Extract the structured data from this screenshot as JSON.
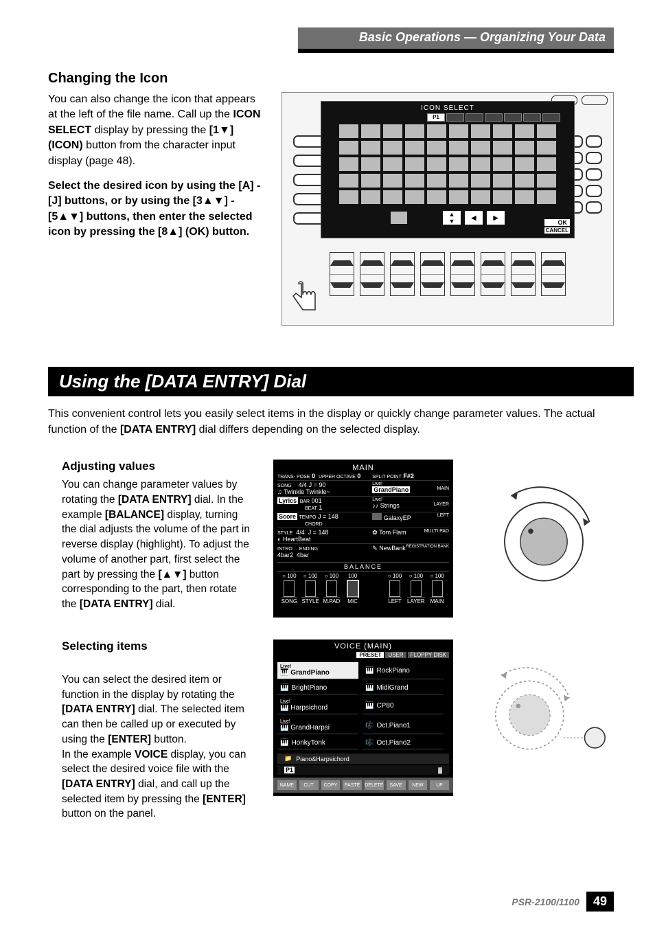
{
  "header": {
    "breadcrumb": "Basic Operations — Organizing Your Data"
  },
  "section_icon": {
    "heading": "Changing the Icon",
    "para1_a": "You can also change the icon that appears at the left of the file name. Call up the ",
    "para1_b": "ICON SELECT",
    "para1_c": " display by pressing the ",
    "para1_d": "[1▼] (ICON)",
    "para1_e": " button from the character input display (page 48).",
    "para2_a": "Select the desired icon by using the [A] - [J] buttons, or by using the [3",
    "para2_b": "] - [5",
    "para2_c": "] buttons, then enter the selected icon by pressing the [8",
    "para2_d": "] (OK) button."
  },
  "lcd_icon": {
    "title": "ICON SELECT",
    "page": "P1",
    "ok": "OK",
    "cancel": "CANCEL"
  },
  "banner": "Using the [DATA ENTRY] Dial",
  "intro_a": "This convenient control lets you easily select items in the display or quickly change parameter values. The actual function of the ",
  "intro_b": "[DATA ENTRY]",
  "intro_c": " dial differs depending on the selected display.",
  "adjust": {
    "heading": "Adjusting values",
    "body_a": "You can change parameter values by rotating the ",
    "body_b": "[DATA ENTRY]",
    "body_c": " dial. In the example ",
    "body_d": "[BALANCE]",
    "body_e": " display, turning the dial adjusts the volume of the part in reverse display (highlight). To adjust the volume of another part, first select the part by pressing the ",
    "body_f": "[",
    "body_g": "]",
    "body_h": " button corresponding to the part, then rotate the ",
    "body_i": "[DATA ENTRY]",
    "body_j": " dial."
  },
  "lcd_main": {
    "title": "MAIN",
    "trans": "TRANS-\nPOSE",
    "trans_v": "0",
    "octave": "UPPER\nOCTAVE",
    "octave_v": "0",
    "split": "SPLIT\nPOINT",
    "split_v": "F#2",
    "song": "SONG",
    "song_name": "Twinkle Twinkle~",
    "time": "4/4",
    "tempo": "J = 90",
    "lyrics": "Lyrics",
    "bar": "BAR",
    "bar_v": "001",
    "beat": "BEAT",
    "beat_v": "1",
    "score": "Score",
    "tempo_l": "TEMPO",
    "tempo_v": "J = 148",
    "chord": "CHORD",
    "style": "STYLE",
    "style_name": "HeartBeat",
    "intro": "INTRO",
    "intro_v": "4bar2",
    "ending": "ENDING",
    "ending_v": "4bar",
    "live": "Live!",
    "main_voice": "GrandPiano",
    "vright_label": "MAIN",
    "layer": "LAYER",
    "layer_v": "Strings",
    "left": "LEFT",
    "left_v": "GalaxyEP",
    "mpad": "MULTI PAD",
    "mpad_v": "Tom Flam",
    "regbank": "REGISTRATION BANK",
    "regbank_v": "NewBank",
    "balance": "BALANCE",
    "levels": [
      "SONG",
      "STYLE",
      "M.PAD",
      "MIC",
      "",
      "LEFT",
      "LAYER",
      "MAIN"
    ],
    "lvals": [
      "100",
      "100",
      "100",
      "100",
      "",
      "100",
      "100",
      "100"
    ]
  },
  "select": {
    "heading": "Selecting items",
    "body_a": "You can select the desired item or function in the display by rotating the ",
    "body_b": "[DATA ENTRY]",
    "body_c": " dial. The selected item can then be called up or executed by using the ",
    "body_d": "[ENTER]",
    "body_e": " button.\nIn the example ",
    "body_f": "VOICE",
    "body_g": " display, you can select the desired voice file with the ",
    "body_h": "[DATA ENTRY]",
    "body_i": " dial, and call up the selected item by pressing the ",
    "body_j": "[ENTER]",
    "body_k": " button on the panel."
  },
  "lcd_voice": {
    "title": "VOICE (MAIN)",
    "tabs": [
      "PRESET",
      "USER",
      "FLOPPY DISK"
    ],
    "live": "Live!",
    "items": [
      "GrandPiano",
      "RockPiano",
      "BrightPiano",
      "MidiGrand",
      "Harpsichord",
      "CP80",
      "GrandHarpsi",
      "Oct.Piano1",
      "HonkyTonk",
      "Oct.Piano2"
    ],
    "category": "Piano&Harpsichord",
    "page": "P1",
    "bottom": [
      "NAME",
      "CUT",
      "COPY",
      "PASTE",
      "DELETE",
      "SAVE",
      "NEW",
      "UP"
    ]
  },
  "footer": {
    "model": "PSR-2100/1100",
    "page": "49"
  }
}
